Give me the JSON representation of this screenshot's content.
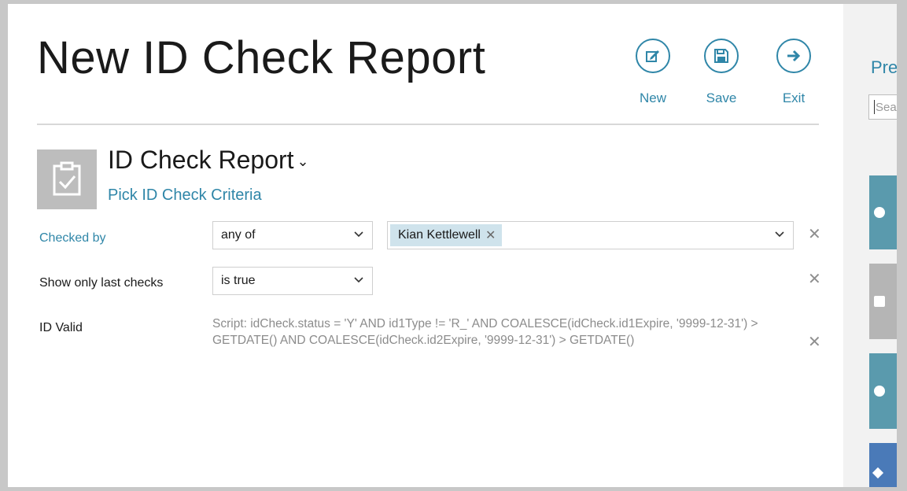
{
  "header": {
    "title": "New ID Check Report",
    "buttons": {
      "new": "New",
      "save": "Save",
      "exit": "Exit"
    }
  },
  "report": {
    "name": "ID Check Report",
    "pick_criteria": "Pick ID Check Criteria"
  },
  "criteria": {
    "checked_by": {
      "label": "Checked by",
      "operator": "any of",
      "selected": [
        "Kian Kettlewell"
      ]
    },
    "show_only_last_checks": {
      "label": "Show only last checks",
      "operator": "is true"
    },
    "id_valid": {
      "label": "ID Valid",
      "script": "Script: idCheck.status = 'Y' AND id1Type != 'R_' AND COALESCE(idCheck.id1Expire, '9999-12-31') > GETDATE() AND COALESCE(idCheck.id2Expire, '9999-12-31') > GETDATE()"
    }
  },
  "right_panel": {
    "title": "Pre",
    "search_placeholder": "Sear",
    "tiles": [
      {
        "color": "#5a9aad"
      },
      {
        "color": "#b5b5b5"
      },
      {
        "color": "#5a9aad"
      },
      {
        "color": "#4a7ab8"
      }
    ]
  },
  "colors": {
    "accent": "#2f86a8",
    "tag_bg": "#cfe3ec"
  },
  "icons": {
    "new": "edit-icon",
    "save": "save-icon",
    "exit": "arrow-right-icon",
    "report": "clipboard-check-icon",
    "remove": "close-icon",
    "dropdown": "chevron-down-icon"
  }
}
